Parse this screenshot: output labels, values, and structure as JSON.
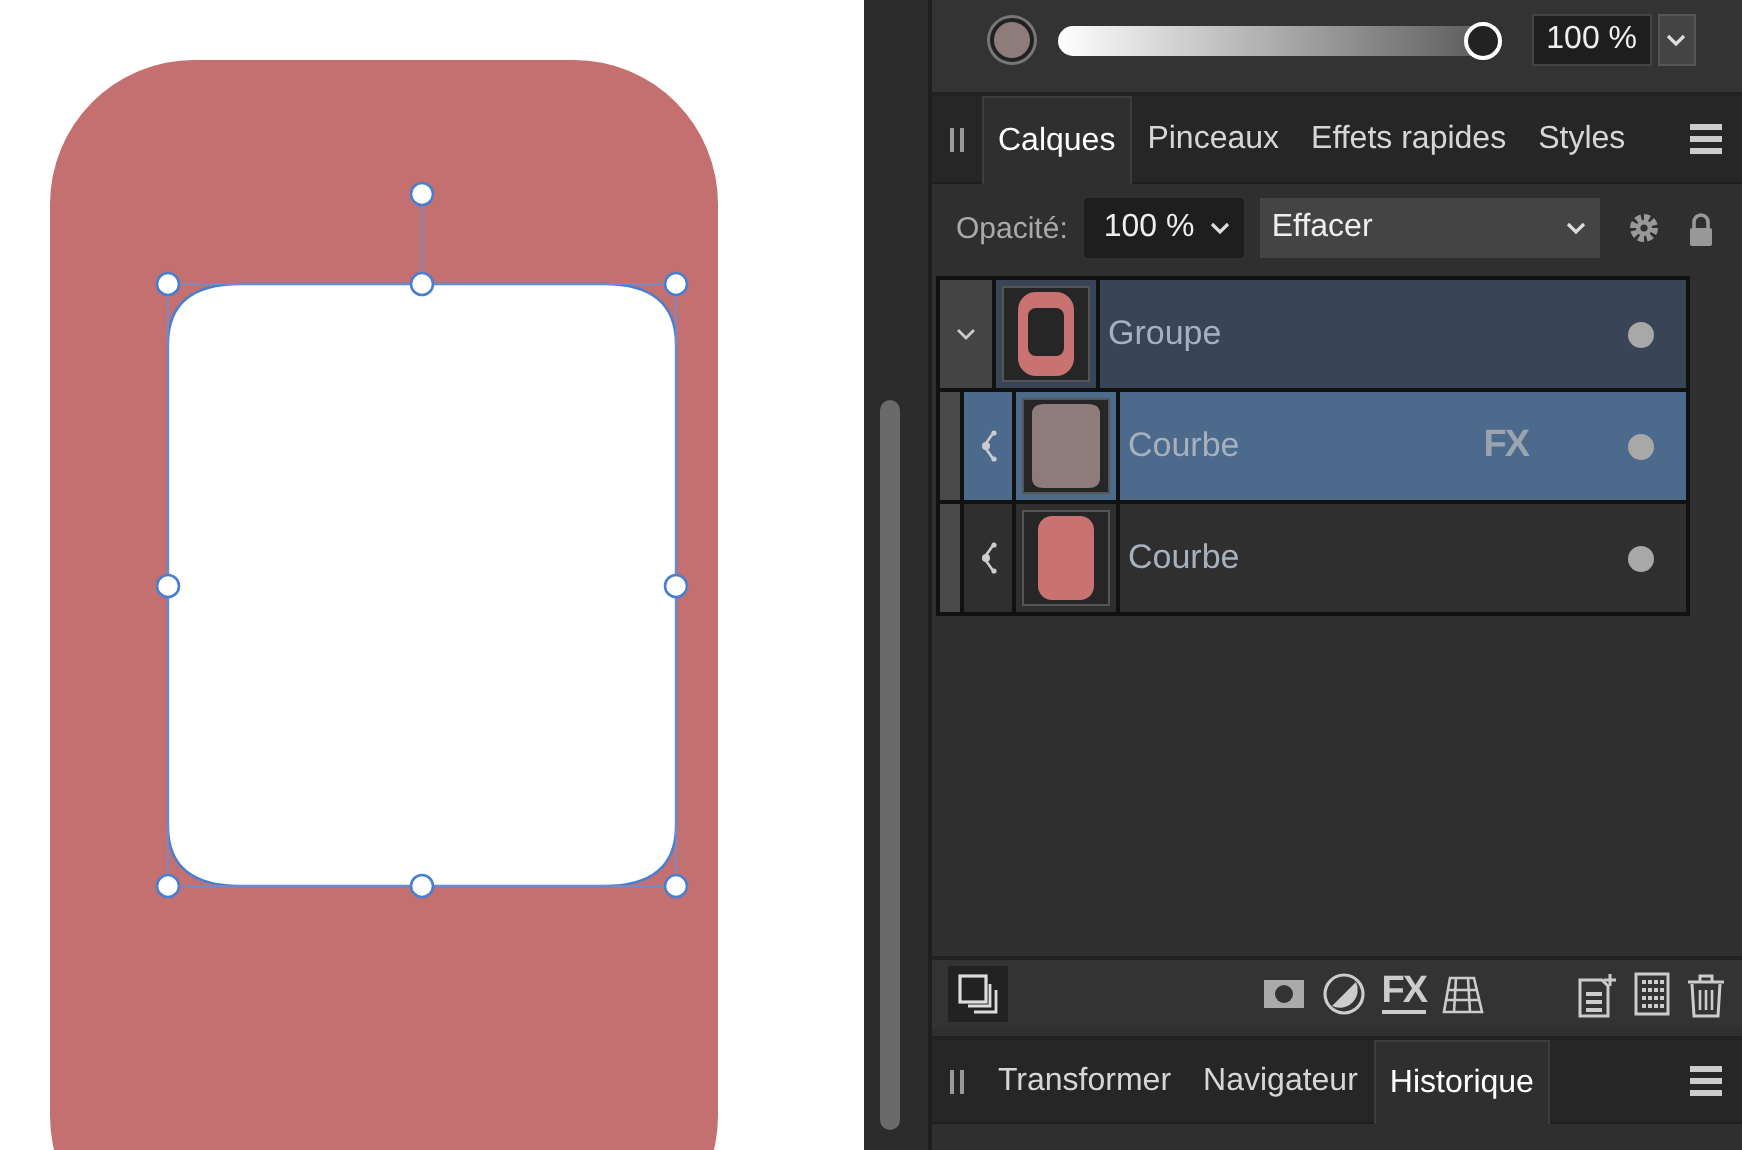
{
  "opacity_bar": {
    "color": "#8e7c7b",
    "level": 1.0,
    "value": "100 %"
  },
  "panel_tabs": [
    {
      "label": "Calques",
      "selected": true
    },
    {
      "label": "Pinceaux",
      "selected": false
    },
    {
      "label": "Effets rapides",
      "selected": false
    },
    {
      "label": "Styles",
      "selected": false
    }
  ],
  "layer_options": {
    "label": "Opacité:",
    "opacity": "100 %",
    "blend_mode": "Effacer"
  },
  "layers": [
    {
      "name": "Groupe",
      "kind": "group",
      "expanded": true,
      "selected": false,
      "visible": true,
      "color": "#c87272",
      "children": [
        {
          "name": "Courbe",
          "kind": "curve",
          "selected": true,
          "visible": true,
          "effects": "FX",
          "color": "#8e7c7b"
        },
        {
          "name": "Courbe",
          "kind": "curve",
          "selected": false,
          "visible": true,
          "color": "#c87272"
        }
      ]
    }
  ],
  "layer_toolbar": {
    "fx_label": "FX"
  },
  "bottom_tabs": [
    {
      "label": "Transformer",
      "selected": false
    },
    {
      "label": "Navigateur",
      "selected": false
    },
    {
      "label": "Historique",
      "selected": true
    }
  ]
}
